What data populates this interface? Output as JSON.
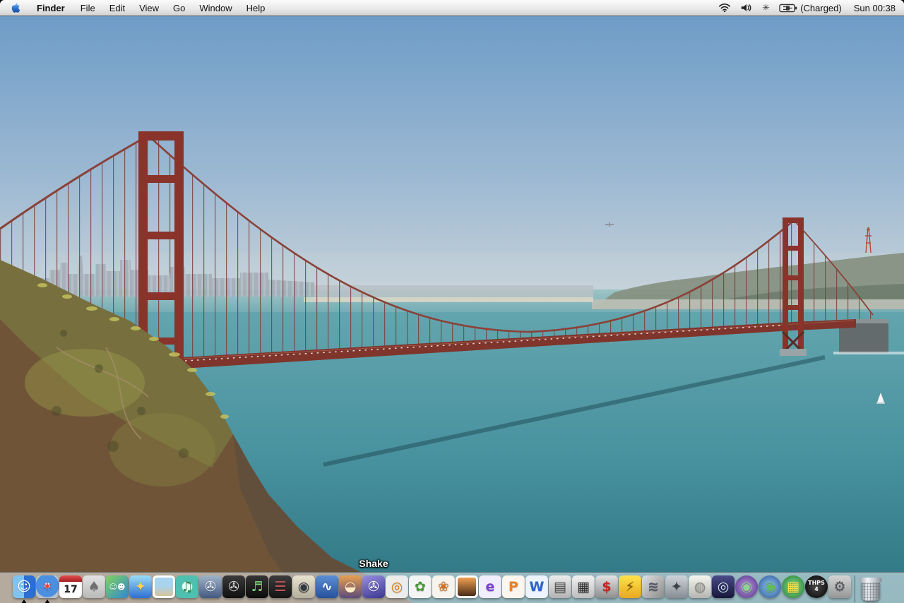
{
  "menubar": {
    "menus": [
      {
        "id": "finder",
        "label": "Finder",
        "flags": [
          "bold"
        ]
      },
      {
        "id": "file",
        "label": "File"
      },
      {
        "id": "edit",
        "label": "Edit"
      },
      {
        "id": "view",
        "label": "View"
      },
      {
        "id": "go",
        "label": "Go"
      },
      {
        "id": "window",
        "label": "Window"
      },
      {
        "id": "help",
        "label": "Help"
      }
    ],
    "status": {
      "starburst_glyph": "✳",
      "battery_label": "(Charged)",
      "clock": "Sun 00:38"
    }
  },
  "wallpaper": {
    "description": "Golden Gate Bridge viewed from Marin Headlands with San Francisco skyline, teal bay water, hazy blue sky and a scrub-covered hillside in the left foreground",
    "colors": {
      "sky_top": "#6e9cc7",
      "sky_horizon": "#ccd6db",
      "water": "#4a93a0",
      "bridge": "#8a332b",
      "bridge_deck": "#7f352c",
      "hill": "#6f5438",
      "hill_green": "#7a7840"
    }
  },
  "dock": {
    "tooltip": "Shake",
    "items": [
      {
        "id": "finder",
        "label": "Finder",
        "glyph": "☺",
        "bg": "linear-gradient(90deg,#7fc4f0 50%,#2a6fd4 50%)",
        "fg": "#ffffff",
        "flags": [
          "running"
        ]
      },
      {
        "id": "safari",
        "label": "Safari",
        "glyph": "✶",
        "bg": "radial-gradient(circle at 50% 45%,#eef6ff 0 16%,#4a8fe0 18% 68%,#b9c2cc 70%)",
        "fg": "#e04444",
        "flags": [
          "running"
        ]
      },
      {
        "id": "ical",
        "label": "iCal (17)",
        "glyph": "17",
        "bg": "#ffffff",
        "fg": "#222222",
        "flags": [
          "cal"
        ]
      },
      {
        "id": "apple-app",
        "label": "Apple system app",
        "glyph": "♠",
        "bg": "linear-gradient(#e3e3e3,#b9b9b9)",
        "fg": "#6f6f6f"
      },
      {
        "id": "msn-messenger",
        "label": "MSN Messenger",
        "glyph": "☺☻",
        "bg": "linear-gradient(135deg,#7fd45a,#2f86d4)",
        "fg": "#ffffff",
        "flags": [
          "small"
        ]
      },
      {
        "id": "ichat",
        "label": "iChat AV (AIM)",
        "glyph": "✦",
        "bg": "linear-gradient(#9adcf8,#2f6fd0)",
        "fg": "#ffd34a"
      },
      {
        "id": "preview",
        "label": "Photo viewer",
        "glyph": "",
        "bg": "linear-gradient(180deg,#a8d4f0 45%,#d8c49a)",
        "fg": "#ffffff",
        "flags": [
          "framed"
        ]
      },
      {
        "id": "itunes",
        "label": "iTunes",
        "glyph": "♫",
        "bg": "radial-gradient(circle,#eafcf6 0 30%,#4fc0b0 34%)",
        "fg": "#2a8a4a"
      },
      {
        "id": "imovie",
        "label": "iMovie",
        "glyph": "✇",
        "bg": "linear-gradient(#9fb3c8,#44597f)",
        "fg": "#e8eef6"
      },
      {
        "id": "cinema-tools",
        "label": "Cinema Tools",
        "glyph": "✇",
        "bg": "linear-gradient(#3a3a3a,#101010)",
        "fg": "#d8d8d8"
      },
      {
        "id": "soundtrack",
        "label": "Soundtrack",
        "glyph": "♬",
        "bg": "linear-gradient(#343434,#0c0c0c)",
        "fg": "#7fd47f"
      },
      {
        "id": "final-cut-pro",
        "label": "Final Cut Pro",
        "glyph": "☰",
        "bg": "linear-gradient(#3c3c3c,#141414)",
        "fg": "#cc5555"
      },
      {
        "id": "livetype",
        "label": "LiveType",
        "glyph": "◉",
        "bg": "linear-gradient(#e9e3d1,#b4ae9c)",
        "fg": "#333a44"
      },
      {
        "id": "final-cut-express",
        "label": "Final Cut Express",
        "glyph": "∿",
        "bg": "linear-gradient(#5b8fd4,#27519c)",
        "fg": "#ffffff"
      },
      {
        "id": "dvd-studio-pro",
        "label": "DVD Studio Pro",
        "glyph": "◒",
        "bg": "linear-gradient(180deg,#e8a050,#5a4a7a)",
        "fg": "#ffe9c4"
      },
      {
        "id": "shake",
        "label": "Shake",
        "glyph": "✇",
        "bg": "linear-gradient(160deg,#9a8fe0,#3a3690)",
        "fg": "#ffffff",
        "flags": [
          "hovered"
        ]
      },
      {
        "id": "blender",
        "label": "Blender",
        "glyph": "◎",
        "bg": "#ececec",
        "fg": "#e87d0d"
      },
      {
        "id": "sketch-app",
        "label": "Painting app",
        "glyph": "✿",
        "bg": "#f4f4f4",
        "fg": "#4a9a3a"
      },
      {
        "id": "painter",
        "label": "Painter (rooster)",
        "glyph": "❀",
        "bg": "#f7f4ee",
        "fg": "#d07020"
      },
      {
        "id": "iphoto",
        "label": "iPhoto",
        "glyph": "",
        "bg": "linear-gradient(180deg,#f0a050,#4a2d18)",
        "fg": "#ffffff",
        "flags": [
          "framed"
        ]
      },
      {
        "id": "entourage",
        "label": "Microsoft Entourage",
        "glyph": "e",
        "bg": "#f1eefb",
        "fg": "#7b3fd4"
      },
      {
        "id": "powerpoint",
        "label": "Microsoft PowerPoint",
        "glyph": "P",
        "bg": "#fdf6ee",
        "fg": "#e8822a"
      },
      {
        "id": "word",
        "label": "Microsoft Word",
        "glyph": "W",
        "bg": "#eef4fd",
        "fg": "#2a66c8"
      },
      {
        "id": "photo-printer",
        "label": "Photo printer utility",
        "glyph": "▤",
        "bg": "linear-gradient(#ececec,#b4b4b4)",
        "fg": "#555555"
      },
      {
        "id": "register-device",
        "label": "Printer/register device",
        "glyph": "▦",
        "bg": "linear-gradient(#f2f2f2,#bdbdbd)",
        "fg": "#333333"
      },
      {
        "id": "money-app",
        "label": "Money app ($ ?)",
        "glyph": "$",
        "bg": "linear-gradient(#e2e2e2,#8e8e8e)",
        "fg": "#cc2222"
      },
      {
        "id": "pikachu-game",
        "label": "Pikachu game",
        "glyph": "⚡",
        "bg": "linear-gradient(#ffe34a,#e8a820)",
        "fg": "#7a5a00"
      },
      {
        "id": "metallic-logo-game",
        "label": "Metallic logo game",
        "glyph": "≋",
        "bg": "linear-gradient(135deg,#e0e0e0,#8a8a8a)",
        "fg": "#555566"
      },
      {
        "id": "skater-game",
        "label": "Skateboarding game",
        "glyph": "✦",
        "bg": "linear-gradient(#cfd4d9,#868d95)",
        "fg": "#3c4248"
      },
      {
        "id": "ufo-game",
        "label": "White dome game",
        "glyph": "◍",
        "bg": "linear-gradient(#f6f6f1,#b5b5b1)",
        "fg": "#8a8a86"
      },
      {
        "id": "screen-capture-app",
        "label": "Screen capture app",
        "glyph": "◎",
        "bg": "linear-gradient(#4a4a8a,#17173a)",
        "fg": "#cfe6ee"
      },
      {
        "id": "purple-orb-game",
        "label": "Purple eye orb game",
        "glyph": "◉",
        "bg": "radial-gradient(circle,#b89ae0,#532f86)",
        "fg": "#8fd48f",
        "flags": [
          "round"
        ]
      },
      {
        "id": "globe-game",
        "label": "Blue globe game",
        "glyph": "◉",
        "bg": "radial-gradient(circle,#9ac8f0,#235299)",
        "fg": "#5fbc5f",
        "flags": [
          "round"
        ]
      },
      {
        "id": "green-orb-game",
        "label": "Green blocks game",
        "glyph": "▦",
        "bg": "radial-gradient(circle,#8ae08a,#1f7a33)",
        "fg": "#ffe34a",
        "flags": [
          "round"
        ]
      },
      {
        "id": "thps4",
        "label": "Tony Hawk's Pro Skater 4",
        "glyph": "THPS 4",
        "bg": "radial-gradient(circle,#4a4a4a,#000000)",
        "fg": "#ffffff",
        "flags": [
          "round",
          "tiny"
        ]
      },
      {
        "id": "chip-utility",
        "label": "Hardware chip utility",
        "glyph": "⚙",
        "bg": "linear-gradient(#d4d4d4,#969696)",
        "fg": "#4e5358"
      }
    ]
  }
}
